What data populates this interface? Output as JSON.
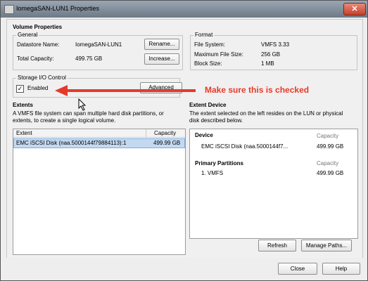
{
  "window": {
    "title": "IomegaSAN-LUN1 Properties"
  },
  "volume_properties": {
    "heading": "Volume Properties",
    "general": {
      "heading": "General",
      "datastore_name_label": "Datastore Name:",
      "datastore_name_value": "IomegaSAN-LUN1",
      "total_capacity_label": "Total Capacity:",
      "total_capacity_value": "499.75 GB",
      "rename_label": "Rename...",
      "increase_label": "Increase..."
    },
    "format": {
      "heading": "Format",
      "file_system_label": "File System:",
      "file_system_value": "VMFS 3.33",
      "max_file_size_label": "Maximum File Size:",
      "max_file_size_value": "256 GB",
      "block_size_label": "Block Size:",
      "block_size_value": "1 MB"
    },
    "storage_io": {
      "heading": "Storage I/O Control",
      "enabled_label": "Enabled",
      "enabled_checked": true,
      "advanced_label": "Advanced"
    }
  },
  "annotation": {
    "text": "Make sure this is checked",
    "color": "#e53a2a"
  },
  "extents": {
    "heading": "Extents",
    "description": "A VMFS file system can span multiple hard disk partitions, or extents, to create a single logical volume.",
    "columns": [
      "Extent",
      "Capacity"
    ],
    "rows": [
      {
        "extent": "EMC iSCSI Disk (naa.5000144f79884113):1",
        "capacity": "499.99 GB"
      }
    ]
  },
  "extent_device": {
    "heading": "Extent Device",
    "description": "The extent selected on the left resides on the LUN or physical disk described below.",
    "device_heading": "Device",
    "device_capacity_heading": "Capacity",
    "device_name": "EMC iSCSI Disk (naa.5000144f7...",
    "device_capacity": "499.99 GB",
    "partitions_heading": "Primary Partitions",
    "partitions_capacity_heading": "Capacity",
    "partition_name": "1. VMFS",
    "partition_capacity": "499.99 GB"
  },
  "buttons": {
    "refresh": "Refresh",
    "manage_paths": "Manage Paths...",
    "close": "Close",
    "help": "Help"
  }
}
